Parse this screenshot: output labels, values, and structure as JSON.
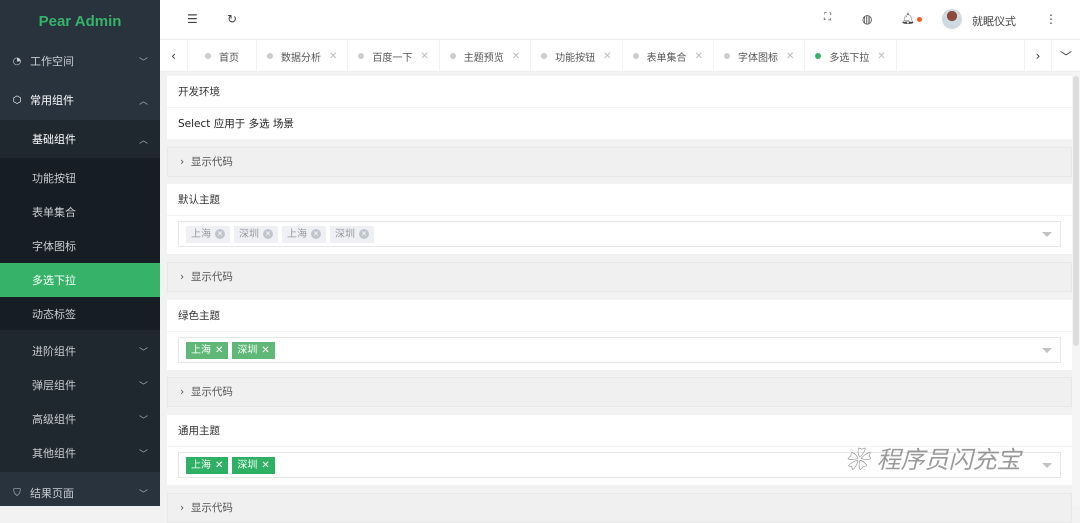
{
  "sidebar": {
    "logo": "Pear Admin",
    "items": [
      {
        "label": "工作空间"
      },
      {
        "label": "常用组件"
      },
      {
        "label": "基础组件"
      },
      {
        "label": "功能按钮"
      },
      {
        "label": "表单集合"
      },
      {
        "label": "字体图标"
      },
      {
        "label": "多选下拉"
      },
      {
        "label": "动态标签"
      },
      {
        "label": "进阶组件"
      },
      {
        "label": "弹层组件"
      },
      {
        "label": "高级组件"
      },
      {
        "label": "其他组件"
      },
      {
        "label": "结果页面"
      }
    ]
  },
  "header": {
    "username": "就眠仪式"
  },
  "tabs": [
    {
      "label": "首页"
    },
    {
      "label": "数据分析"
    },
    {
      "label": "百度一下"
    },
    {
      "label": "主题预览"
    },
    {
      "label": "功能按钮"
    },
    {
      "label": "表单集合"
    },
    {
      "label": "字体图标"
    },
    {
      "label": "多选下拉"
    }
  ],
  "content": {
    "env_title": "开发环境",
    "desc": "Select 应用于 多选 场景",
    "show_code": "显示代码",
    "sections": [
      {
        "title": "默认主题",
        "tags": [
          "上海",
          "深圳",
          "上海",
          "深圳"
        ]
      },
      {
        "title": "绿色主题",
        "tags": [
          "上海",
          "深圳"
        ]
      },
      {
        "title": "通用主题",
        "tags": [
          "上海",
          "深圳"
        ]
      }
    ]
  },
  "watermark": "程序员闪充宝",
  "colors": {
    "accent": "#36b368",
    "sidebar": "#28333e",
    "notify": "#ff5722"
  }
}
